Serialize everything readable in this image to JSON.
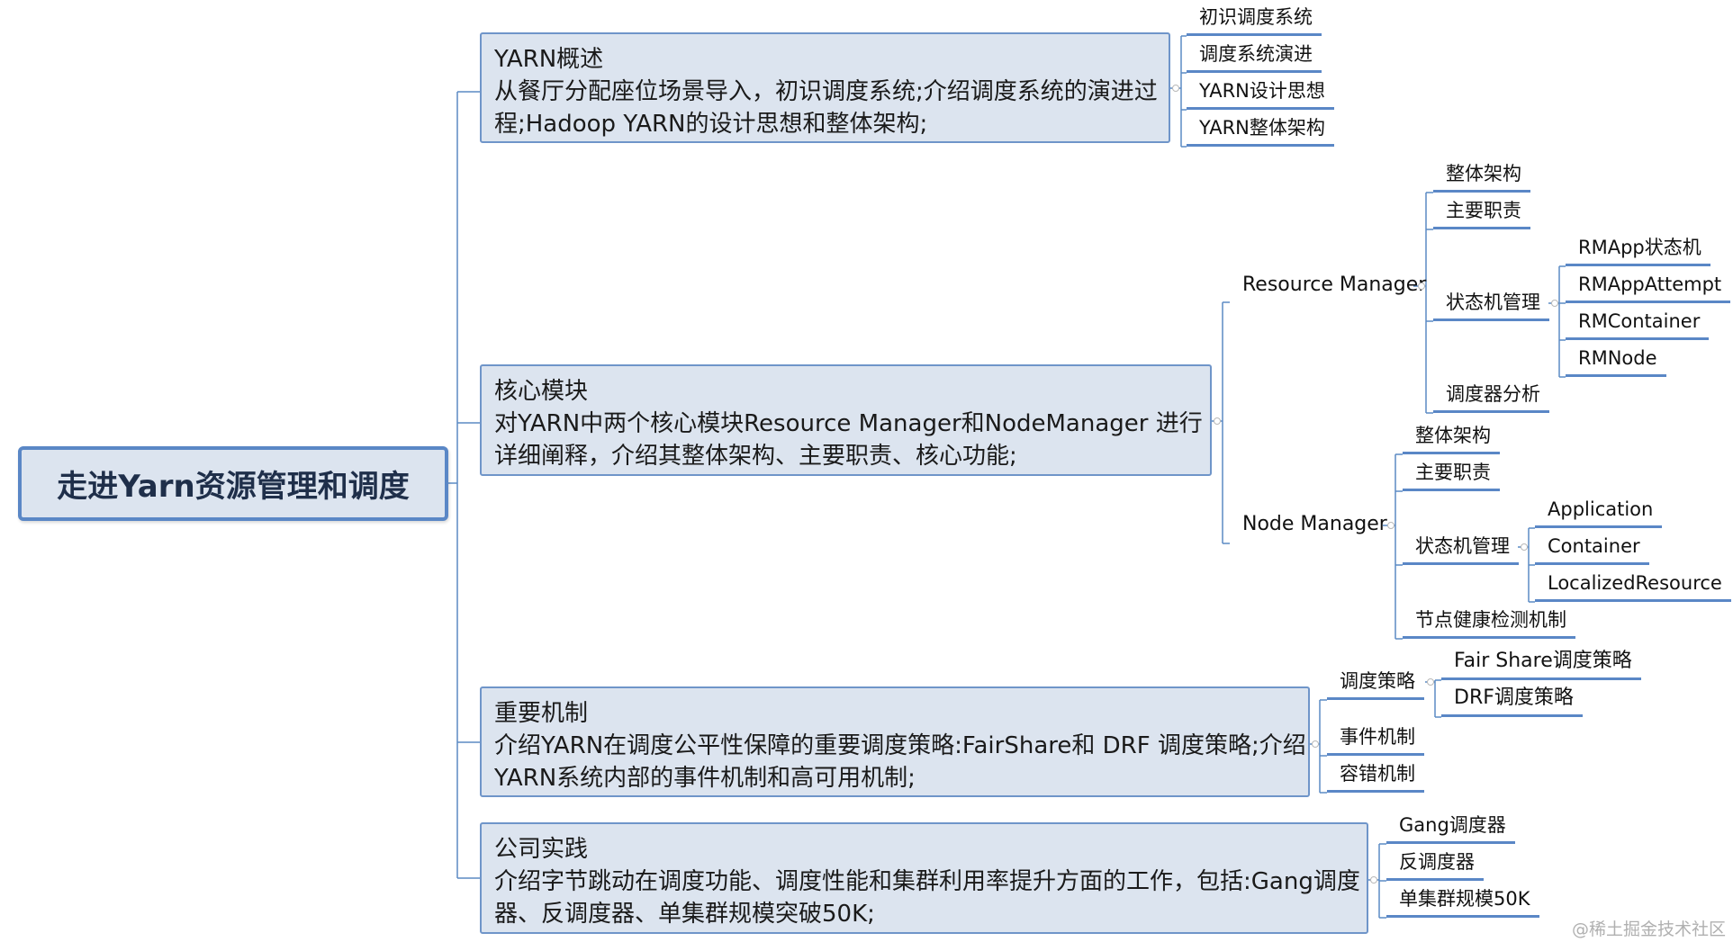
{
  "root": {
    "label": "走进Yarn资源管理和调度"
  },
  "overview": {
    "title": "YARN概述",
    "desc1": "从餐厅分配座位场景导入，初识调度系统;介绍调度系统的演进过",
    "desc2": "程;Hadoop YARN的设计思想和整体架构;",
    "children": [
      "初识调度系统",
      "调度系统演进",
      "YARN设计思想",
      "YARN整体架构"
    ]
  },
  "core": {
    "title": "核心模块",
    "desc1": "对YARN中两个核心模块Resource Manager和NodeManager 进行",
    "desc2": "详细阐释，介绍其整体架构、主要职责、核心功能;",
    "rm": {
      "label": "Resource Manager",
      "children": [
        "整体架构",
        "主要职责",
        "状态机管理",
        "调度器分析"
      ],
      "state_machines": [
        "RMApp状态机",
        "RMAppAttempt",
        "RMContainer",
        "RMNode"
      ]
    },
    "nm": {
      "label": "Node Manager",
      "children": [
        "整体架构",
        "主要职责",
        "状态机管理",
        "节点健康检测机制"
      ],
      "state_machines": [
        "Application",
        "Container",
        "LocalizedResource"
      ]
    }
  },
  "mechanism": {
    "title": "重要机制",
    "desc1": "介绍YARN在调度公平性保障的重要调度策略:FairShare和 DRF 调度策略;介绍",
    "desc2": "YARN系统内部的事件机制和高可用机制;",
    "children": [
      "调度策略",
      "事件机制",
      "容错机制"
    ],
    "policies": [
      "Fair Share调度策略",
      "DRF调度策略"
    ]
  },
  "practice": {
    "title": "公司实践",
    "desc1": "介绍字节跳动在调度功能、调度性能和集群利用率提升方面的工作，包括:Gang调度",
    "desc2": "器、反调度器、单集群规模突破50K;",
    "children": [
      "Gang调度器",
      "反调度器",
      "单集群规模50K"
    ]
  },
  "watermark": "@稀土掘金技术社区",
  "colors": {
    "accent": "#5a87c6",
    "node_fill": "#dce4ef",
    "line": "#5b8ac4"
  }
}
